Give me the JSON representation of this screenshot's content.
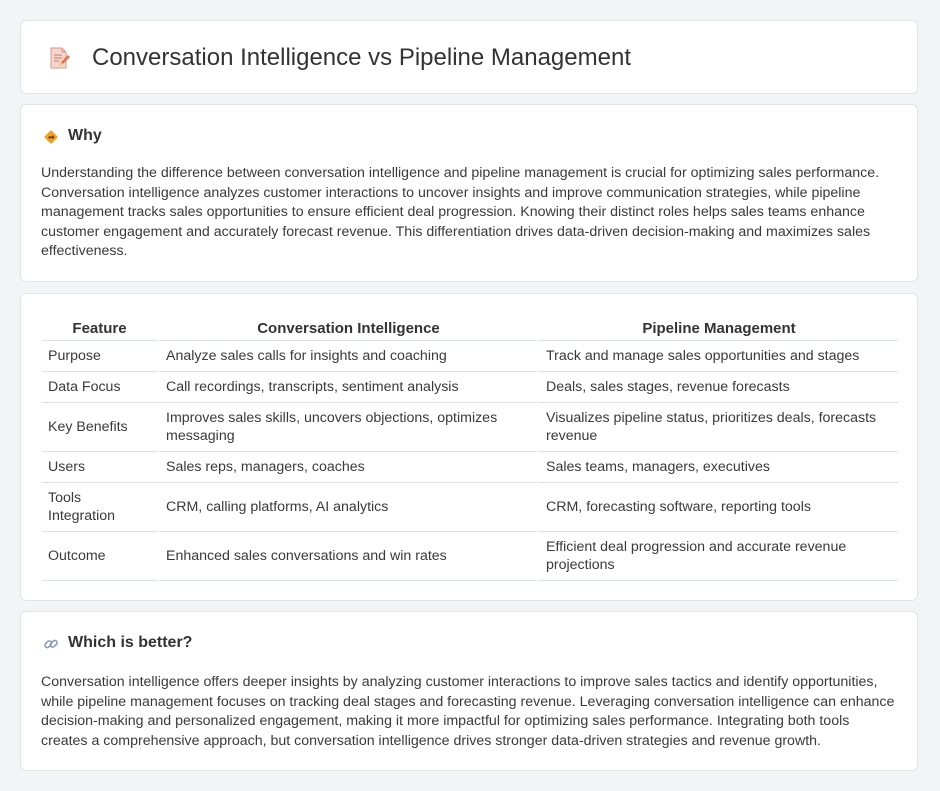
{
  "header": {
    "title": "Conversation Intelligence vs Pipeline Management",
    "icon": "document-pencil-icon"
  },
  "why": {
    "icon": "diamond-direction-icon",
    "title": "Why",
    "text": "Understanding the difference between conversation intelligence and pipeline management is crucial for optimizing sales performance. Conversation intelligence analyzes customer interactions to uncover insights and improve communication strategies, while pipeline management tracks sales opportunities to ensure efficient deal progression. Knowing their distinct roles helps sales teams enhance customer engagement and accurately forecast revenue. This differentiation drives data-driven decision-making and maximizes sales effectiveness."
  },
  "table": {
    "headers": [
      "Feature",
      "Conversation Intelligence",
      "Pipeline Management"
    ],
    "rows": [
      [
        "Purpose",
        "Analyze sales calls for insights and coaching",
        "Track and manage sales opportunities and stages"
      ],
      [
        "Data Focus",
        "Call recordings, transcripts, sentiment analysis",
        "Deals, sales stages, revenue forecasts"
      ],
      [
        "Key Benefits",
        "Improves sales skills, uncovers objections, optimizes messaging",
        "Visualizes pipeline status, prioritizes deals, forecasts revenue"
      ],
      [
        "Users",
        "Sales reps, managers, coaches",
        "Sales teams, managers, executives"
      ],
      [
        "Tools Integration",
        "CRM, calling platforms, AI analytics",
        "CRM, forecasting software, reporting tools"
      ],
      [
        "Outcome",
        "Enhanced sales conversations and win rates",
        "Efficient deal progression and accurate revenue projections"
      ]
    ]
  },
  "better": {
    "icon": "link-icon",
    "title": "Which is better?",
    "text": "Conversation intelligence offers deeper insights by analyzing customer interactions to improve sales tactics and identify opportunities, while pipeline management focuses on tracking deal stages and forecasting revenue. Leveraging conversation intelligence can enhance decision-making and personalized engagement, making it more impactful for optimizing sales performance. Integrating both tools creates a comprehensive approach, but conversation intelligence drives stronger data-driven strategies and revenue growth."
  }
}
